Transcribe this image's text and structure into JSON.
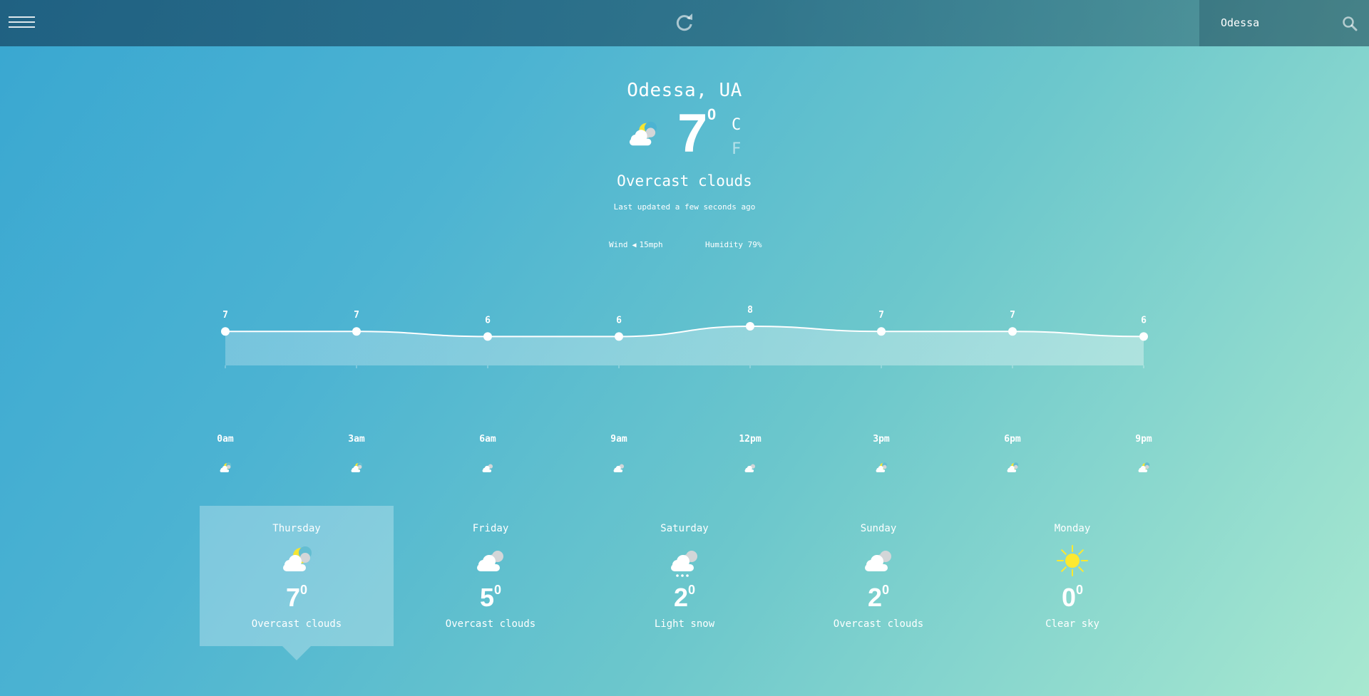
{
  "header": {
    "menu_icon": "hamburger-icon",
    "refresh_icon": "refresh-icon",
    "search": {
      "value": "Odessa",
      "icon": "search-icon"
    }
  },
  "current": {
    "location": "Odessa, UA",
    "temperature": "7",
    "degree_symbol": "0",
    "unit_c": "C",
    "unit_f": "F",
    "condition": "Overcast clouds",
    "icon": "partly-cloudy-night-icon",
    "last_updated": "Last updated a few seconds ago",
    "wind": {
      "label": "Wind",
      "value": "15mph",
      "icon": "wind-direction-arrow-icon"
    },
    "humidity": {
      "label": "Humidity",
      "value": "79%"
    }
  },
  "chart_data": {
    "type": "area",
    "x": [
      "0am",
      "3am",
      "6am",
      "9am",
      "12pm",
      "3pm",
      "6pm",
      "9pm"
    ],
    "series": [
      {
        "values": [
          7,
          7,
          6,
          6,
          8,
          7,
          7,
          6
        ]
      }
    ],
    "ylim": [
      0,
      8
    ],
    "grid": false
  },
  "hourly": [
    {
      "label": "0am",
      "icon": "partly-cloudy-night-icon"
    },
    {
      "label": "3am",
      "icon": "partly-cloudy-night-icon"
    },
    {
      "label": "6am",
      "icon": "cloud-icon"
    },
    {
      "label": "9am",
      "icon": "cloud-icon"
    },
    {
      "label": "12pm",
      "icon": "cloud-icon"
    },
    {
      "label": "3pm",
      "icon": "partly-cloudy-night-icon"
    },
    {
      "label": "6pm",
      "icon": "partly-cloudy-night-icon"
    },
    {
      "label": "9pm",
      "icon": "partly-cloudy-night-icon"
    }
  ],
  "daily": [
    {
      "day": "Thursday",
      "temp": "7",
      "deg": "0",
      "condition": "Overcast clouds",
      "icon": "partly-cloudy-night-icon",
      "selected": true
    },
    {
      "day": "Friday",
      "temp": "5",
      "deg": "0",
      "condition": "Overcast clouds",
      "icon": "cloudy-icon",
      "selected": false
    },
    {
      "day": "Saturday",
      "temp": "2",
      "deg": "0",
      "condition": "Light snow",
      "icon": "snow-cloud-icon",
      "selected": false
    },
    {
      "day": "Sunday",
      "temp": "2",
      "deg": "0",
      "condition": "Overcast clouds",
      "icon": "cloudy-icon",
      "selected": false
    },
    {
      "day": "Monday",
      "temp": "0",
      "deg": "0",
      "condition": "Clear sky",
      "icon": "sun-icon",
      "selected": false
    }
  ],
  "colors": {
    "moon": "#f5e532",
    "sun": "#fde92f",
    "cloud_front": "#ffffff",
    "cloud_back": "#d3d6d8"
  }
}
